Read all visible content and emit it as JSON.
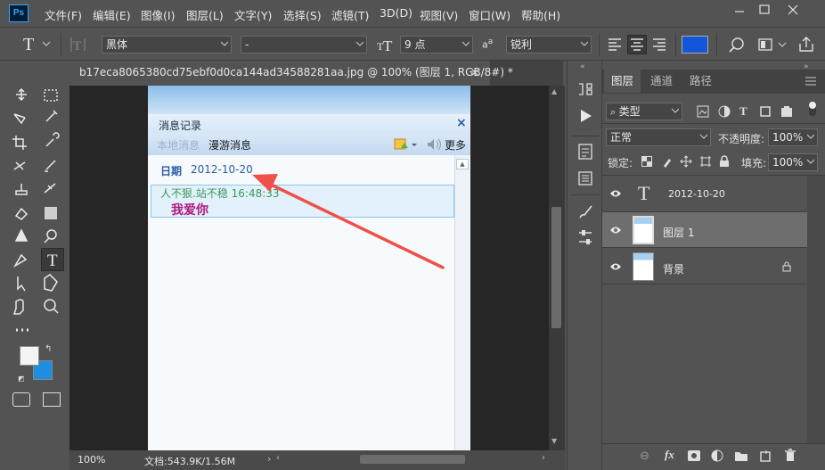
{
  "app": {
    "logo": "Ps"
  },
  "menu": [
    "文件(F)",
    "编辑(E)",
    "图像(I)",
    "图层(L)",
    "文字(Y)",
    "选择(S)",
    "滤镜(T)",
    "3D(D)",
    "视图(V)",
    "窗口(W)",
    "帮助(H)"
  ],
  "options": {
    "font_family": "黑体",
    "font_style": "-",
    "font_size": "9 点",
    "antialias_prefix": "a",
    "antialias": "锐利",
    "color": "#1357d9"
  },
  "document": {
    "tab_title": "b17eca8065380cd75ebf0d0ca144ad34588281aa.jpg @ 100% (图层 1, RGB/8#) *",
    "zoom": "100%",
    "doc_info": "文档:543.9K/1.56M"
  },
  "qq": {
    "window_title": "消息记录",
    "tab_local": "本地消息",
    "tab_roaming": "漫游消息",
    "more": "更多",
    "date_label": "日期",
    "date_value": "2012-10-20",
    "sender_line": "人不狠.站不稳 16:48:33",
    "message": "我爱你"
  },
  "layers_panel": {
    "tabs": [
      "图层",
      "通道",
      "路径"
    ],
    "filter_kind": "类型",
    "blend_mode": "正常",
    "opacity_label": "不透明度:",
    "opacity_value": "100%",
    "lock_label": "锁定:",
    "fill_label": "填充:",
    "fill_value": "100%",
    "layers": [
      {
        "name": "2012-10-20",
        "kind": "text"
      },
      {
        "name": "图层 1",
        "kind": "image"
      },
      {
        "name": "背景",
        "kind": "background"
      }
    ]
  },
  "colors": {
    "foreground": "#f4f4f4",
    "background": "#1e8fe0",
    "annotation_arrow": "#f0504a",
    "qq_date_blue": "#2a5ca8",
    "qq_sender_green": "#3a9a58",
    "qq_message_purple": "#b0177f"
  }
}
